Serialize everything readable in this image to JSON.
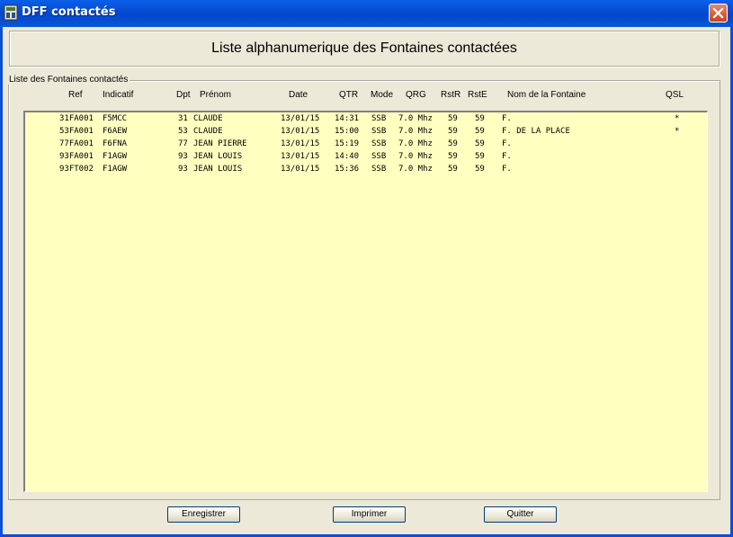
{
  "window": {
    "title": "DFF contactés"
  },
  "header": {
    "title": "Liste alphanumerique des Fontaines contactées"
  },
  "group": {
    "legend": "Liste des Fontaines contactés"
  },
  "columns": {
    "ref": "Ref",
    "indicatif": "Indicatif",
    "dpt": "Dpt",
    "prenom": "Prénom",
    "date": "Date",
    "qtr": "QTR",
    "mode": "Mode",
    "qrg": "QRG",
    "rstr": "RstR",
    "rste": "RstE",
    "nom": "Nom de la Fontaine",
    "qsl": "QSL"
  },
  "rows": [
    {
      "ref": "31FA001",
      "indicatif": "F5MCC",
      "dpt": "31",
      "prenom": "CLAUDE",
      "date": "13/01/15",
      "qtr": "14:31",
      "mode": "SSB",
      "qrg": "7.0 Mhz",
      "rstr": "59",
      "rste": "59",
      "nom": "F.",
      "qsl": "*"
    },
    {
      "ref": "53FA001",
      "indicatif": "F6AEW",
      "dpt": "53",
      "prenom": "CLAUDE",
      "date": "13/01/15",
      "qtr": "15:00",
      "mode": "SSB",
      "qrg": "7.0 Mhz",
      "rstr": "59",
      "rste": "59",
      "nom": "F. DE LA PLACE",
      "qsl": "*"
    },
    {
      "ref": "77FA001",
      "indicatif": "F6FNA",
      "dpt": "77",
      "prenom": "JEAN PIERRE",
      "date": "13/01/15",
      "qtr": "15:19",
      "mode": "SSB",
      "qrg": "7.0 Mhz",
      "rstr": "59",
      "rste": "59",
      "nom": "F.",
      "qsl": ""
    },
    {
      "ref": "93FA001",
      "indicatif": "F1AGW",
      "dpt": "93",
      "prenom": "JEAN LOUIS",
      "date": "13/01/15",
      "qtr": "14:40",
      "mode": "SSB",
      "qrg": "7.0 Mhz",
      "rstr": "59",
      "rste": "59",
      "nom": "F.",
      "qsl": ""
    },
    {
      "ref": "93FT002",
      "indicatif": "F1AGW",
      "dpt": "93",
      "prenom": "JEAN LOUIS",
      "date": "13/01/15",
      "qtr": "15:36",
      "mode": "SSB",
      "qrg": "7.0 Mhz",
      "rstr": "59",
      "rste": "59",
      "nom": "F.",
      "qsl": ""
    }
  ],
  "buttons": {
    "save": "Enregistrer",
    "print": "Imprimer",
    "quit": "Quitter"
  },
  "colors": {
    "list_background": "#ffffc0",
    "titlebar": "#0446cc",
    "dialog_background": "#ece9d8"
  },
  "icons": {
    "app": "app-window-icon",
    "close": "close-icon"
  }
}
